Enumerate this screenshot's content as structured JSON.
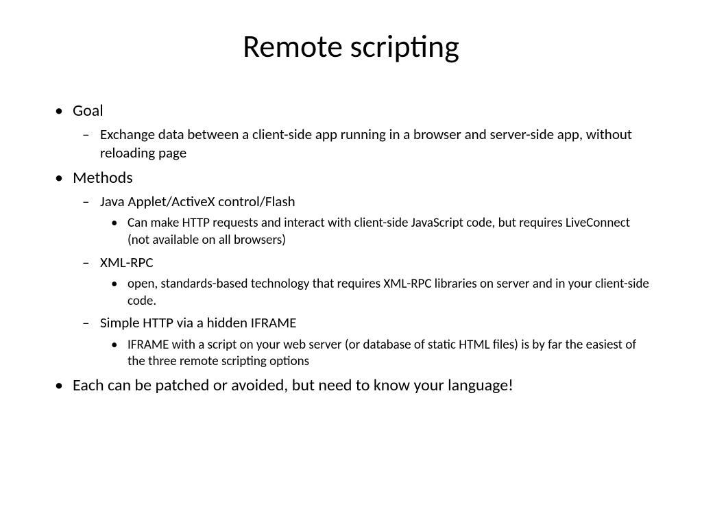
{
  "title": "Remote scripting",
  "bullets": {
    "goal": {
      "label": "Goal",
      "sub1": "Exchange data between a client-side app running in a browser and server-side app,  without reloading page"
    },
    "methods": {
      "label": "Methods",
      "m1": {
        "label": "Java Applet/ActiveX control/Flash",
        "detail": "Can make HTTP requests and interact with client-side JavaScript code,  but requires LiveConnect (not available on all browsers)"
      },
      "m2": {
        "label": "XML-RPC",
        "detail": "open, standards-based technology that requires XML-RPC libraries on server and in your client-side code."
      },
      "m3": {
        "label": "Simple HTTP via a hidden IFRAME",
        "detail": "IFRAME with a script on your web server (or database of static HTML files) is by far the easiest of the three remote scripting options"
      }
    },
    "closing": "Each can be patched or avoided, but need to know your language!"
  }
}
